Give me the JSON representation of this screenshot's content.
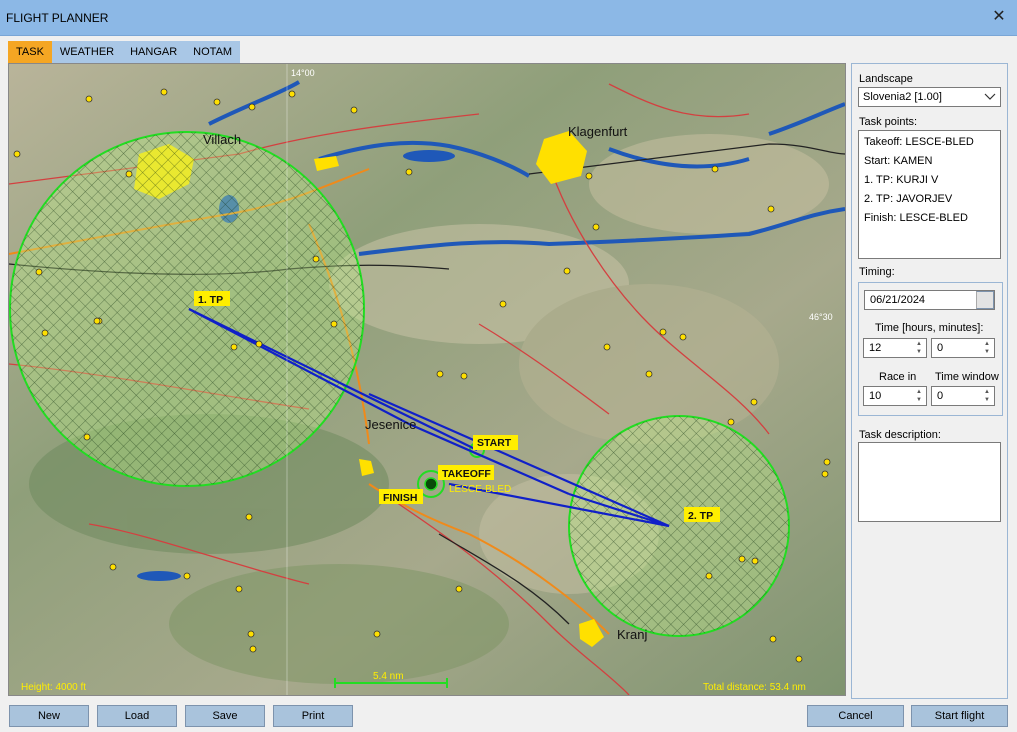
{
  "window": {
    "title": "FLIGHT PLANNER",
    "close_icon": "close-icon"
  },
  "tabs": [
    "TASK",
    "WEATHER",
    "HANGAR",
    "NOTAM"
  ],
  "active_tab": "TASK",
  "map": {
    "towns": [
      "Villach",
      "Klagenfurt",
      "Jesenice",
      "Kranj"
    ],
    "airfield_name": "LESCE-BLED",
    "tp_tags": {
      "tp1": "1. TP",
      "tp2": "2. TP",
      "start": "START",
      "takeoff": "TAKEOFF",
      "finish": "FINISH"
    },
    "coord_top": "14°00",
    "coord_right": "46°30",
    "height": "Height: 4000 ft",
    "scale": "5.4 nm",
    "total_distance": "Total distance: 53.4 nm",
    "colors": {
      "cylinder": "#22dd22",
      "route": "#1020c8",
      "tag": "#ffee00",
      "water": "#1f58b8",
      "town": "#ffe000"
    }
  },
  "panel": {
    "landscape_label": "Landscape",
    "landscape_value": "Slovenia2 [1.00]",
    "taskpoints_label": "Task points:",
    "taskpoints": [
      "Takeoff: LESCE-BLED",
      "Start: KAMEN",
      "1. TP: KURJI V",
      "2. TP: JAVORJEV",
      "Finish: LESCE-BLED"
    ],
    "timing_label": "Timing:",
    "date": "06/21/2024",
    "time_label": "Time [hours, minutes]:",
    "hours": "12",
    "minutes": "0",
    "race_in_label": "Race in",
    "race_in": "10",
    "time_window_label": "Time window",
    "time_window": "0",
    "desc_label": "Task description:"
  },
  "buttons": {
    "new": "New",
    "load": "Load",
    "save": "Save",
    "print": "Print",
    "cancel": "Cancel",
    "start": "Start flight"
  }
}
